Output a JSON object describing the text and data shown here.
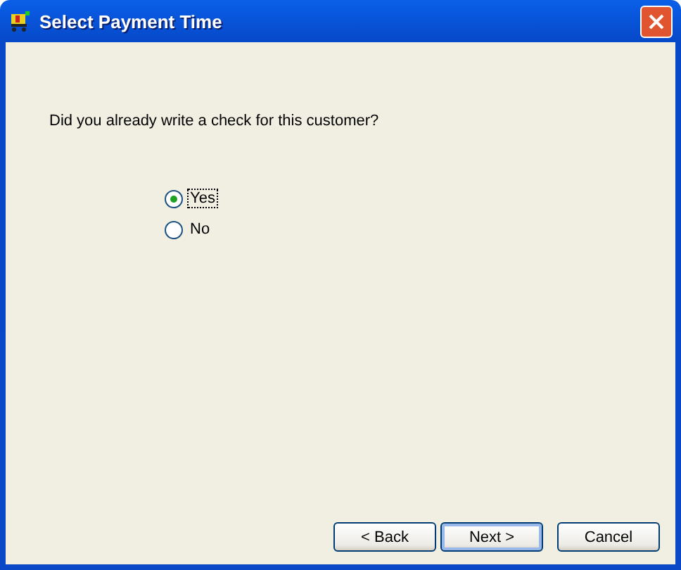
{
  "window": {
    "title": "Select Payment Time"
  },
  "question": "Did you already write a check for this customer?",
  "options": [
    {
      "label": "Yes",
      "selected": true,
      "focused": true
    },
    {
      "label": "No",
      "selected": false,
      "focused": false
    }
  ],
  "buttons": [
    {
      "label": "< Back",
      "default": false
    },
    {
      "label": "Next >",
      "default": true
    },
    {
      "label": "Cancel",
      "default": false
    }
  ]
}
